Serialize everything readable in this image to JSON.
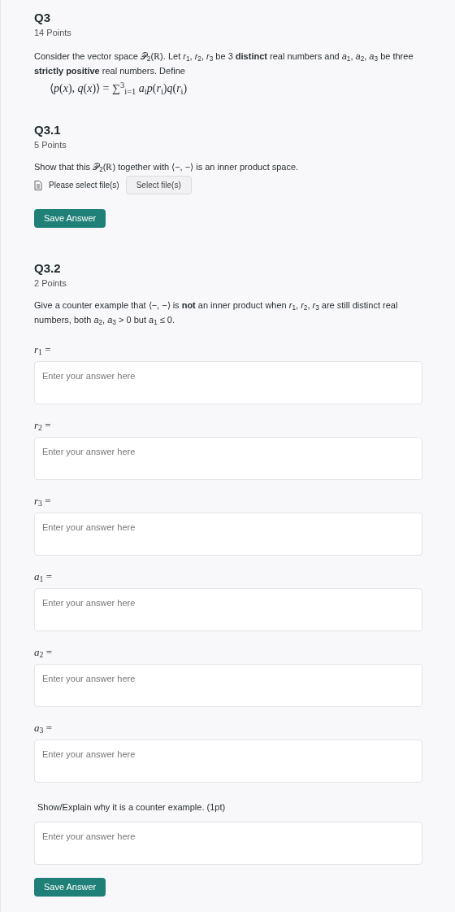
{
  "question": {
    "title": "Q3",
    "points": "14 Points",
    "prompt": "Consider the vector space 𝒫$_{2}$(ℝ). Let *r*$_{1}$, *r*$_{2}$, *r*$_{3}$ be 3 **distinct** real numbers and *a*$_{1}$, *a*$_{2}$, *a*$_{3}$ be three **strictly positive** real numbers. Define",
    "formula": "⟨*p*(*x*), *q*(*x*)⟩ = ∑$^{3}$$_{i=1}$ *a*$_{i}$*p*(*r*$_{i}$)*q*(*r*$_{i}$)"
  },
  "parts": [
    {
      "title": "Q3.1",
      "points": "5 Points",
      "prompt": "Show that this 𝒫$_{2}$(ℝ) together with ⟨−, −⟩ is an inner product space.",
      "file_upload": {
        "status": "Please select file(s)",
        "button": "Select file(s)"
      },
      "save_button": "Save Answer"
    },
    {
      "title": "Q3.2",
      "points": "2 Points",
      "prompt": "Give a counter example that ⟨−, −⟩ is **not** an inner product when *r*$_{1}$, *r*$_{2}$, *r*$_{3}$ are still distinct real numbers, both *a*$_{2}$, *a*$_{3}$ > 0 but *a*$_{1}$ ≤ 0.",
      "answers": [
        {
          "label": "*r*$_{1}$ =",
          "placeholder": "Enter your answer here"
        },
        {
          "label": "*r*$_{2}$ =",
          "placeholder": "Enter your answer here"
        },
        {
          "label": "*r*$_{3}$ =",
          "placeholder": "Enter your answer here"
        },
        {
          "label": "*a*$_{1}$ =",
          "placeholder": "Enter your answer here"
        },
        {
          "label": "*a*$_{2}$ =",
          "placeholder": "Enter your answer here"
        },
        {
          "label": "*a*$_{3}$ =",
          "placeholder": "Enter your answer here"
        }
      ],
      "explain": {
        "label": "Show/Explain why it is a counter example. (1pt)",
        "placeholder": "Enter your answer here"
      },
      "save_button": "Save Answer"
    }
  ]
}
